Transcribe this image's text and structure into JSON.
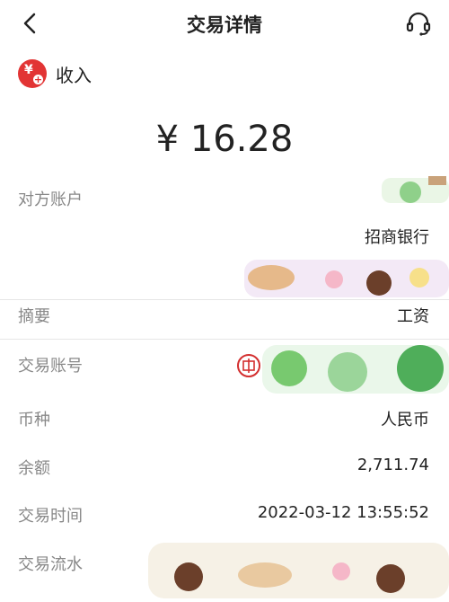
{
  "header": {
    "title": "交易详情",
    "back_icon": "chevron-left-icon",
    "service_icon": "headset-icon"
  },
  "transaction": {
    "type_label": "收入",
    "type_icon": "income-yen-icon",
    "amount": "¥ 16.28"
  },
  "fields": {
    "counterparty_label": "对方账户",
    "counterparty_bank": "招商银行",
    "summary_label": "摘要",
    "summary_value": "工资",
    "account_label": "交易账号",
    "currency_label": "币种",
    "currency_value": "人民币",
    "balance_label": "余额",
    "balance_value": "2,711.74",
    "time_label": "交易时间",
    "time_value": "2022-03-12 13:55:52",
    "serial_label": "交易流水"
  },
  "colors": {
    "accent": "#e23434",
    "label": "#888888",
    "value": "#222222"
  }
}
